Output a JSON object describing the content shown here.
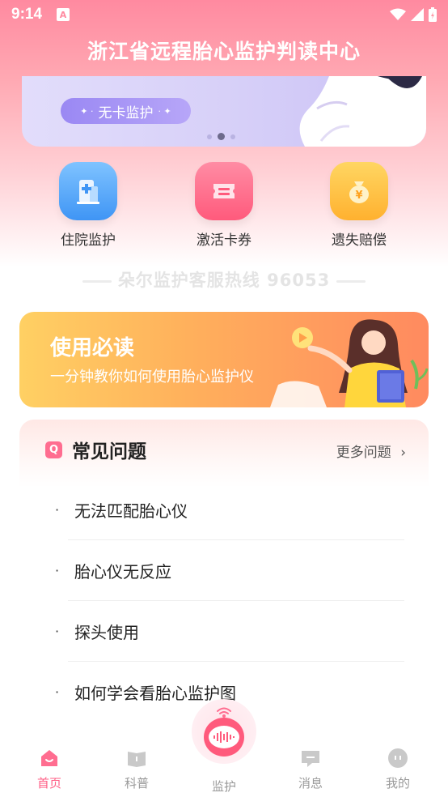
{
  "status_bar": {
    "time": "9:14",
    "notification_letter": "A"
  },
  "app_title": "浙江省远程胎心监护判读中心",
  "banner": {
    "pill_text": "无卡监护",
    "pill_sparkle": "+ ·",
    "slides": 3,
    "active_slide": 2
  },
  "quick_actions": [
    {
      "label": "住院监护",
      "icon": "hospital-icon"
    },
    {
      "label": "激活卡券",
      "icon": "ticket-icon"
    },
    {
      "label": "遗失赔偿",
      "icon": "money-bag-icon"
    }
  ],
  "hotline": "朵尔监护客服热线 96053",
  "guide": {
    "title": "使用必读",
    "subtitle": "一分钟教你如何使用胎心监护仪"
  },
  "faq": {
    "title": "常见问题",
    "q_badge": "Q",
    "more_label": "更多问题",
    "more_chevron": "›",
    "bullet": "·",
    "items": [
      "无法匹配胎心仪",
      "胎心仪无反应",
      "探头使用",
      "如何学会看胎心监护图"
    ]
  },
  "bottom_nav": {
    "items": [
      {
        "label": "首页",
        "icon": "home-icon",
        "active": true
      },
      {
        "label": "科普",
        "icon": "book-icon",
        "active": false
      },
      {
        "label": "监护",
        "icon": "monitor-icon",
        "active": false
      },
      {
        "label": "消息",
        "icon": "message-icon",
        "active": false
      },
      {
        "label": "我的",
        "icon": "profile-icon",
        "active": false
      }
    ]
  },
  "colors": {
    "accent": "#ff5f86",
    "header_gradient": "#ff8aa0",
    "banner_purple": "#9a88f3"
  }
}
